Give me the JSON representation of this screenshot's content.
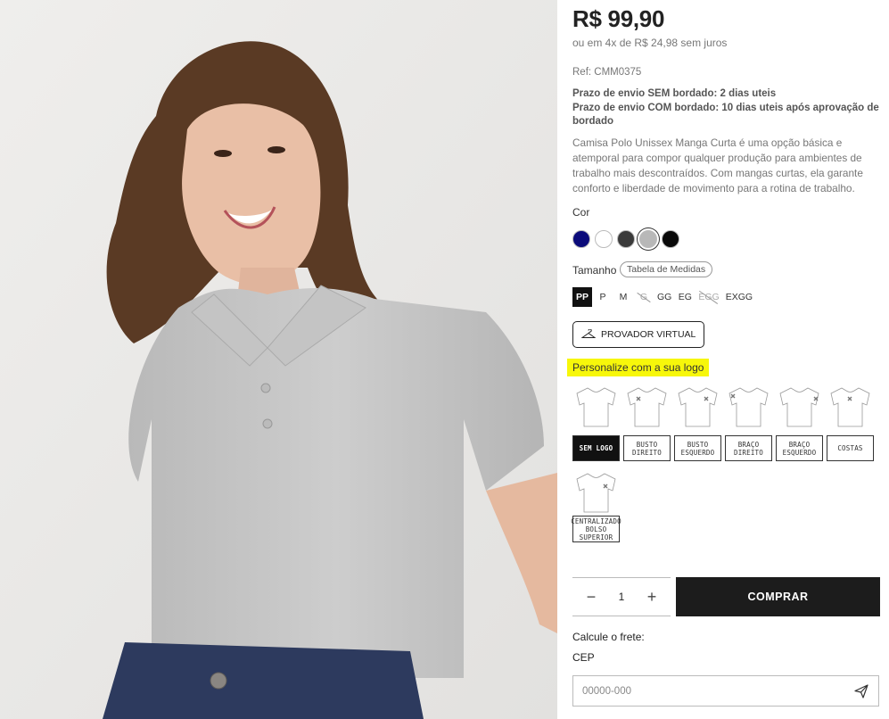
{
  "product": {
    "price": "R$ 99,90",
    "installments": "ou em 4x de R$ 24,98 sem juros",
    "ref": "Ref: CMM0375",
    "shipping_without": "Prazo de envio SEM bordado: 2 dias uteis",
    "shipping_with": "Prazo de envio COM bordado: 10 dias uteis após aprovação de bordado",
    "description": "Camisa Polo Unissex Manga Curta é uma opção básica e atemporal para compor qualquer produção para ambientes de trabalho mais descontraídos. Com mangas curtas, ela garante conforto e liberdade de movimento para a rotina de trabalho."
  },
  "color": {
    "label": "Cor",
    "swatches": [
      {
        "name": "navy",
        "hex": "#0b0b7a"
      },
      {
        "name": "white",
        "hex": "#ffffff"
      },
      {
        "name": "charcoal",
        "hex": "#3a3a3a"
      },
      {
        "name": "gray",
        "hex": "#b8b8b8",
        "selected": true
      },
      {
        "name": "black",
        "hex": "#0a0a0a"
      }
    ]
  },
  "size": {
    "label": "Tamanho",
    "guide": "Tabela de Medidas",
    "options": [
      {
        "label": "PP",
        "state": "active"
      },
      {
        "label": "P",
        "state": "available"
      },
      {
        "label": "M",
        "state": "available"
      },
      {
        "label": "G",
        "state": "unavailable"
      },
      {
        "label": "GG",
        "state": "available"
      },
      {
        "label": "EG",
        "state": "available"
      },
      {
        "label": "EGG",
        "state": "unavailable"
      },
      {
        "label": "EXGG",
        "state": "available"
      }
    ]
  },
  "tryon": {
    "label": "PROVADOR VIRTUAL",
    "icon": "hanger-icon"
  },
  "personalize": {
    "title": "Personalize com a sua logo",
    "options": [
      {
        "id": "sem-logo",
        "label": "SEM LOGO",
        "active": true,
        "mark": "none"
      },
      {
        "id": "busto-direito",
        "label": "BUSTO DIREITO",
        "mark": "left-chest"
      },
      {
        "id": "busto-esquerdo",
        "label": "BUSTO ESQUERDO",
        "mark": "right-chest"
      },
      {
        "id": "braco-direito",
        "label": "BRAÇO DIREITO",
        "mark": "left-sleeve"
      },
      {
        "id": "braco-esquerdo",
        "label": "BRAÇO ESQUERDO",
        "mark": "right-sleeve"
      },
      {
        "id": "costas",
        "label": "COSTAS",
        "mark": "back"
      },
      {
        "id": "centralizado",
        "label": "CENTRALIZADO BOLSO SUPERIOR",
        "mark": "center"
      }
    ]
  },
  "cart": {
    "quantity": "1",
    "minus": "−",
    "plus": "+",
    "buy_label": "COMPRAR"
  },
  "freight": {
    "label": "Calcule o frete:",
    "cep_label": "CEP",
    "cep_placeholder": "00000-000",
    "send_icon": "send-icon"
  }
}
